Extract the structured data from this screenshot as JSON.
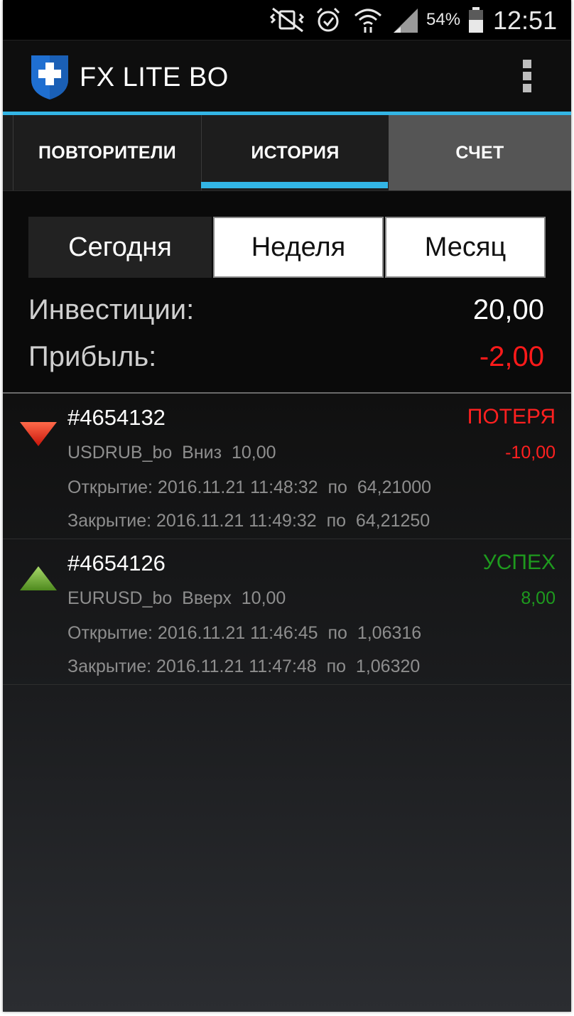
{
  "status_bar": {
    "icons": [
      "vibrate-mute-icon",
      "alarm-icon",
      "wifi-icon",
      "signal-icon",
      "battery-icon"
    ],
    "battery": "54%",
    "time": "12:51"
  },
  "app": {
    "title": "FX LITE BO",
    "accent_color": "#33b5e5"
  },
  "tabs": [
    {
      "label": "ПОВТОРИТЕЛИ",
      "active": false
    },
    {
      "label": "ИСТОРИЯ",
      "active": true
    },
    {
      "label": "СЧЕТ",
      "active": false
    }
  ],
  "filters": {
    "options": [
      "Сегодня",
      "Неделя",
      "Месяц"
    ],
    "selected": "Сегодня"
  },
  "summary": {
    "investments_label": "Инвестиции:",
    "investments_value": "20,00",
    "profit_label": "Прибыль:",
    "profit_value": "-2,00",
    "profit_color": "#ff1a1a"
  },
  "trades": [
    {
      "id": "#4654132",
      "status": "ПОТЕРЯ",
      "status_color": "#ff2020",
      "direction_icon": "arrow-down-icon",
      "info": "USDRUB_bo  Вниз  10,00",
      "amount": "-10,00",
      "open": "Открытие: 2016.11.21 11:48:32  по  64,21000",
      "close": "Закрытие: 2016.11.21 11:49:32  по  64,21250"
    },
    {
      "id": "#4654126",
      "status": "УСПЕХ",
      "status_color": "#1e9a1e",
      "direction_icon": "arrow-up-icon",
      "info": "EURUSD_bo  Вверх  10,00",
      "amount": "8,00",
      "open": "Открытие: 2016.11.21 11:46:45  по  1,06316",
      "close": "Закрытие: 2016.11.21 11:47:48  по  1,06320"
    }
  ]
}
